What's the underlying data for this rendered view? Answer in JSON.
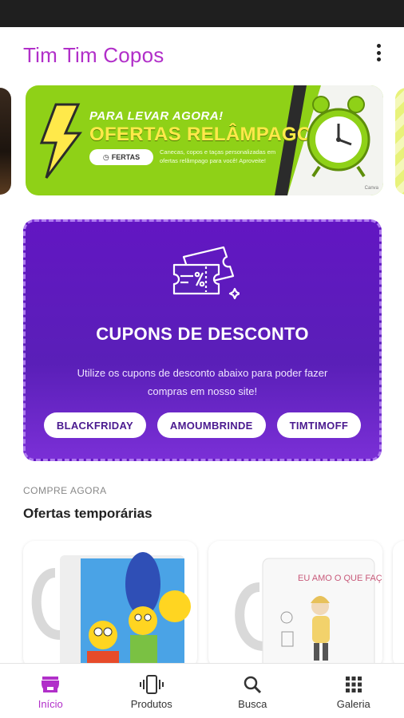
{
  "app": {
    "title": "Tim Tim Copos"
  },
  "banner": {
    "kicker": "PARA LEVAR AGORA!",
    "title": "OFERTAS RELÂMPAGO",
    "button_label": "FERTAS",
    "description": "Canecas, copos e taças personalizadas em ofertas relâmpago para você! Aproveite!",
    "credit": "Canva"
  },
  "coupons": {
    "title": "CUPONS DE DESCONTO",
    "description": "Utilize os cupons de desconto abaixo para poder fazer compras em nosso site!",
    "codes": [
      "BLACKFRIDAY",
      "AMOUMBRINDE",
      "TIMTIMOFF"
    ]
  },
  "section": {
    "kicker": "COMPRE AGORA",
    "title": "Ofertas temporárias"
  },
  "products": [
    {
      "caption": ""
    },
    {
      "caption": "EU AMO O QUE FAÇO"
    }
  ],
  "nav": [
    {
      "label": "Início",
      "icon": "store-icon",
      "active": true
    },
    {
      "label": "Produtos",
      "icon": "phone-vibrate-icon",
      "active": false
    },
    {
      "label": "Busca",
      "icon": "search-icon",
      "active": false
    },
    {
      "label": "Galeria",
      "icon": "grid-icon",
      "active": false
    }
  ],
  "colors": {
    "accent": "#b12fc9",
    "coupon_bg": "#5a1fb8",
    "banner_green": "#8fd117"
  }
}
